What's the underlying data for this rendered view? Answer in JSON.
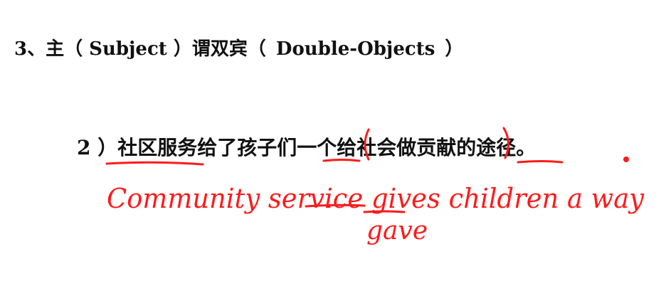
{
  "heading": {
    "number": "3、",
    "cjk_1": "主",
    "paren_1": "（ Subject ）",
    "cjk_2": "谓双宾",
    "paren_open": "（",
    "english": "Double-Objects",
    "paren_close": "）"
  },
  "sentence": {
    "number": "2 ）",
    "text": "社区服务给了孩子们一个给社会做贡献的途径。"
  },
  "annotation": {
    "translation": "Community service gives children a way",
    "correction": "gave"
  },
  "colors": {
    "text": "#111111",
    "annotation": "#ff1a1a",
    "background": "#ffffff"
  }
}
